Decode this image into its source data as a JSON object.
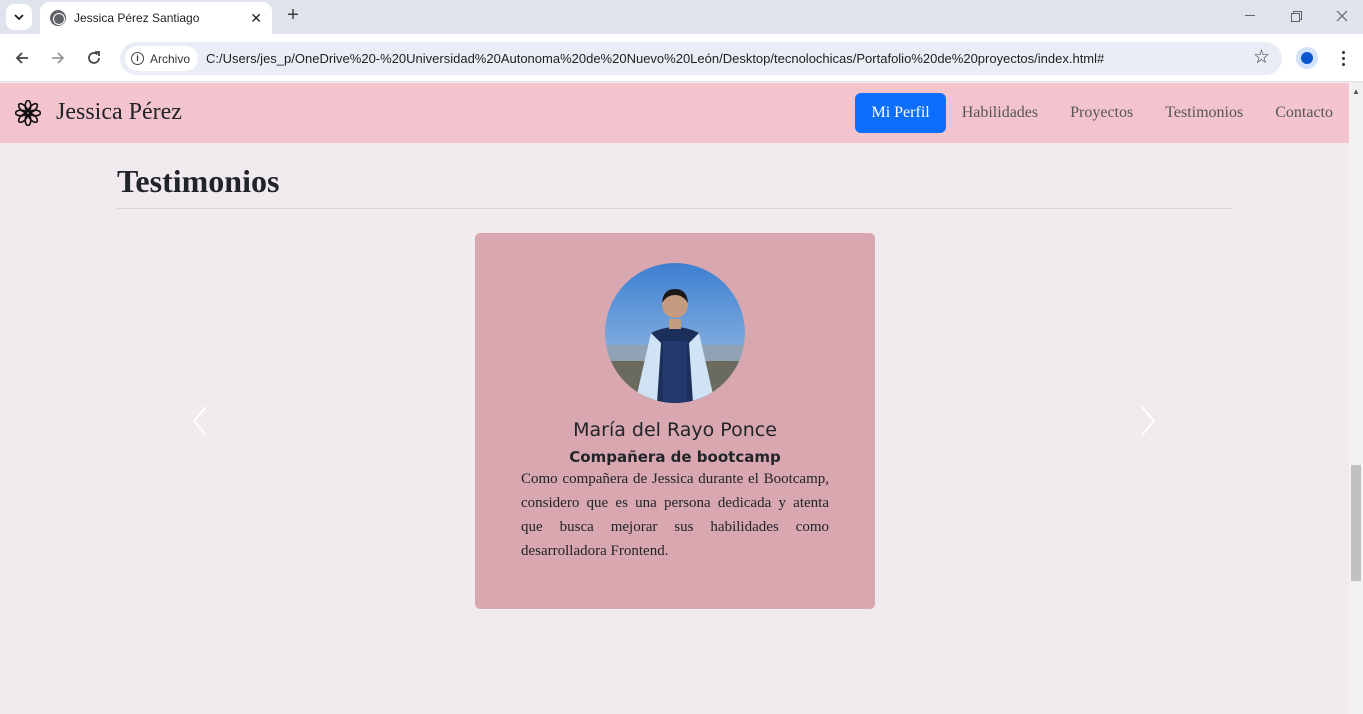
{
  "browser": {
    "tab_title": "Jessica Pérez Santiago",
    "security_chip": "Archivo",
    "url": "C:/Users/jes_p/OneDrive%20-%20Universidad%20Autonoma%20de%20Nuevo%20León/Desktop/tecnolochicas/Portafolio%20de%20proyectos/index.html#"
  },
  "navbar": {
    "brand": "Jessica Pérez",
    "links": [
      {
        "label": "Mi Perfil",
        "active": true
      },
      {
        "label": "Habilidades"
      },
      {
        "label": "Proyectos"
      },
      {
        "label": "Testimonios"
      },
      {
        "label": "Contacto"
      }
    ]
  },
  "section": {
    "title": "Testimonios"
  },
  "testimonial": {
    "name": "María del Rayo Ponce",
    "role": "Compañera de bootcamp",
    "quote": "Como compañera de Jessica durante el Bootcamp, considero que es una persona dedicada y atenta que busca mejorar sus habilidades como desarrolladora Frontend."
  },
  "colors": {
    "navbar_bg": "#f3c4ce",
    "page_bg": "#f1eaef",
    "card_bg": "#d9a7b0",
    "active_link": "#0d6efd"
  }
}
